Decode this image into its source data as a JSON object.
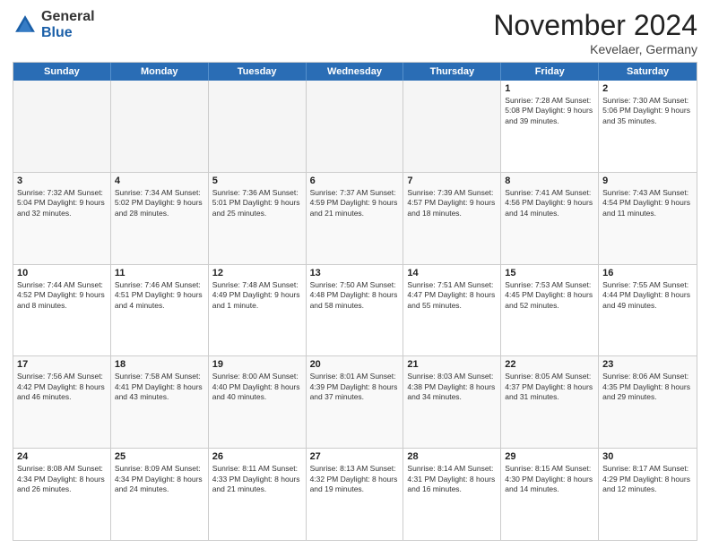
{
  "logo": {
    "general": "General",
    "blue": "Blue"
  },
  "title": "November 2024",
  "location": "Kevelaer, Germany",
  "header": {
    "days": [
      "Sunday",
      "Monday",
      "Tuesday",
      "Wednesday",
      "Thursday",
      "Friday",
      "Saturday"
    ]
  },
  "rows": [
    [
      {
        "day": "",
        "info": "",
        "empty": true
      },
      {
        "day": "",
        "info": "",
        "empty": true
      },
      {
        "day": "",
        "info": "",
        "empty": true
      },
      {
        "day": "",
        "info": "",
        "empty": true
      },
      {
        "day": "",
        "info": "",
        "empty": true
      },
      {
        "day": "1",
        "info": "Sunrise: 7:28 AM\nSunset: 5:08 PM\nDaylight: 9 hours\nand 39 minutes.",
        "empty": false
      },
      {
        "day": "2",
        "info": "Sunrise: 7:30 AM\nSunset: 5:06 PM\nDaylight: 9 hours\nand 35 minutes.",
        "empty": false
      }
    ],
    [
      {
        "day": "3",
        "info": "Sunrise: 7:32 AM\nSunset: 5:04 PM\nDaylight: 9 hours\nand 32 minutes.",
        "empty": false
      },
      {
        "day": "4",
        "info": "Sunrise: 7:34 AM\nSunset: 5:02 PM\nDaylight: 9 hours\nand 28 minutes.",
        "empty": false
      },
      {
        "day": "5",
        "info": "Sunrise: 7:36 AM\nSunset: 5:01 PM\nDaylight: 9 hours\nand 25 minutes.",
        "empty": false
      },
      {
        "day": "6",
        "info": "Sunrise: 7:37 AM\nSunset: 4:59 PM\nDaylight: 9 hours\nand 21 minutes.",
        "empty": false
      },
      {
        "day": "7",
        "info": "Sunrise: 7:39 AM\nSunset: 4:57 PM\nDaylight: 9 hours\nand 18 minutes.",
        "empty": false
      },
      {
        "day": "8",
        "info": "Sunrise: 7:41 AM\nSunset: 4:56 PM\nDaylight: 9 hours\nand 14 minutes.",
        "empty": false
      },
      {
        "day": "9",
        "info": "Sunrise: 7:43 AM\nSunset: 4:54 PM\nDaylight: 9 hours\nand 11 minutes.",
        "empty": false
      }
    ],
    [
      {
        "day": "10",
        "info": "Sunrise: 7:44 AM\nSunset: 4:52 PM\nDaylight: 9 hours\nand 8 minutes.",
        "empty": false
      },
      {
        "day": "11",
        "info": "Sunrise: 7:46 AM\nSunset: 4:51 PM\nDaylight: 9 hours\nand 4 minutes.",
        "empty": false
      },
      {
        "day": "12",
        "info": "Sunrise: 7:48 AM\nSunset: 4:49 PM\nDaylight: 9 hours\nand 1 minute.",
        "empty": false
      },
      {
        "day": "13",
        "info": "Sunrise: 7:50 AM\nSunset: 4:48 PM\nDaylight: 8 hours\nand 58 minutes.",
        "empty": false
      },
      {
        "day": "14",
        "info": "Sunrise: 7:51 AM\nSunset: 4:47 PM\nDaylight: 8 hours\nand 55 minutes.",
        "empty": false
      },
      {
        "day": "15",
        "info": "Sunrise: 7:53 AM\nSunset: 4:45 PM\nDaylight: 8 hours\nand 52 minutes.",
        "empty": false
      },
      {
        "day": "16",
        "info": "Sunrise: 7:55 AM\nSunset: 4:44 PM\nDaylight: 8 hours\nand 49 minutes.",
        "empty": false
      }
    ],
    [
      {
        "day": "17",
        "info": "Sunrise: 7:56 AM\nSunset: 4:42 PM\nDaylight: 8 hours\nand 46 minutes.",
        "empty": false
      },
      {
        "day": "18",
        "info": "Sunrise: 7:58 AM\nSunset: 4:41 PM\nDaylight: 8 hours\nand 43 minutes.",
        "empty": false
      },
      {
        "day": "19",
        "info": "Sunrise: 8:00 AM\nSunset: 4:40 PM\nDaylight: 8 hours\nand 40 minutes.",
        "empty": false
      },
      {
        "day": "20",
        "info": "Sunrise: 8:01 AM\nSunset: 4:39 PM\nDaylight: 8 hours\nand 37 minutes.",
        "empty": false
      },
      {
        "day": "21",
        "info": "Sunrise: 8:03 AM\nSunset: 4:38 PM\nDaylight: 8 hours\nand 34 minutes.",
        "empty": false
      },
      {
        "day": "22",
        "info": "Sunrise: 8:05 AM\nSunset: 4:37 PM\nDaylight: 8 hours\nand 31 minutes.",
        "empty": false
      },
      {
        "day": "23",
        "info": "Sunrise: 8:06 AM\nSunset: 4:35 PM\nDaylight: 8 hours\nand 29 minutes.",
        "empty": false
      }
    ],
    [
      {
        "day": "24",
        "info": "Sunrise: 8:08 AM\nSunset: 4:34 PM\nDaylight: 8 hours\nand 26 minutes.",
        "empty": false
      },
      {
        "day": "25",
        "info": "Sunrise: 8:09 AM\nSunset: 4:34 PM\nDaylight: 8 hours\nand 24 minutes.",
        "empty": false
      },
      {
        "day": "26",
        "info": "Sunrise: 8:11 AM\nSunset: 4:33 PM\nDaylight: 8 hours\nand 21 minutes.",
        "empty": false
      },
      {
        "day": "27",
        "info": "Sunrise: 8:13 AM\nSunset: 4:32 PM\nDaylight: 8 hours\nand 19 minutes.",
        "empty": false
      },
      {
        "day": "28",
        "info": "Sunrise: 8:14 AM\nSunset: 4:31 PM\nDaylight: 8 hours\nand 16 minutes.",
        "empty": false
      },
      {
        "day": "29",
        "info": "Sunrise: 8:15 AM\nSunset: 4:30 PM\nDaylight: 8 hours\nand 14 minutes.",
        "empty": false
      },
      {
        "day": "30",
        "info": "Sunrise: 8:17 AM\nSunset: 4:29 PM\nDaylight: 8 hours\nand 12 minutes.",
        "empty": false
      }
    ]
  ]
}
